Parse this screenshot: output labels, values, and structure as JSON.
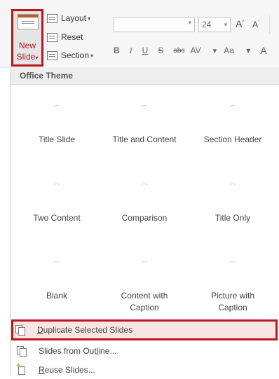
{
  "ribbon": {
    "new_slide_line1": "New",
    "new_slide_line2": "Slide",
    "layout_label": "Layout",
    "reset_label": "Reset",
    "section_label": "Section",
    "font_size": "24",
    "grow_font": "A",
    "shrink_font": "A",
    "bold": "B",
    "italic": "I",
    "underline": "U",
    "shadow": "S",
    "strike": "abc",
    "spacing": "AV",
    "change_case": "Aa",
    "font_color": "A"
  },
  "panel": {
    "header": "Office Theme",
    "layouts": [
      "Title Slide",
      "Title and Content",
      "Section Header",
      "Two Content",
      "Comparison",
      "Title Only",
      "Blank",
      "Content with Caption",
      "Picture with Caption"
    ]
  },
  "menu": {
    "duplicate_first": "D",
    "duplicate_rest": "uplicate Selected Slides",
    "outline_pre": "Slides from Out",
    "outline_u": "l",
    "outline_post": "ine...",
    "reuse_first": "R",
    "reuse_rest": "euse Slides..."
  },
  "colors": {
    "highlight_border": "#b8171d",
    "highlight_fill": "#f9e6e3",
    "ribbon_bg": "#f6f6f6"
  }
}
